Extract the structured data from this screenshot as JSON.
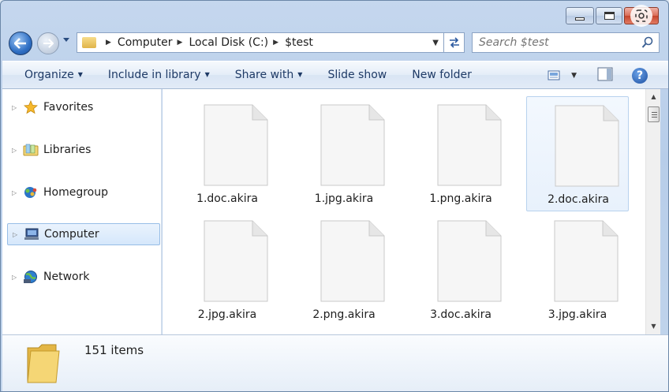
{
  "window": {
    "colors": {
      "accent": "#2f6fc4",
      "close": "#d96c57",
      "selection": "#d5e7fb"
    }
  },
  "address": {
    "crumbs": [
      "Computer",
      "Local Disk (C:)",
      "$test"
    ]
  },
  "search": {
    "placeholder": "Search $test"
  },
  "toolbar": {
    "organize": "Organize",
    "include_in_library": "Include in library",
    "share_with": "Share with",
    "slide_show": "Slide show",
    "new_folder": "New folder"
  },
  "nav": {
    "items": [
      {
        "label": "Favorites",
        "icon": "star-icon"
      },
      {
        "label": "Libraries",
        "icon": "libraries-icon"
      },
      {
        "label": "Homegroup",
        "icon": "homegroup-icon"
      },
      {
        "label": "Computer",
        "icon": "computer-icon",
        "selected": true
      },
      {
        "label": "Network",
        "icon": "network-icon"
      }
    ]
  },
  "files": [
    {
      "name": "1.doc.akira"
    },
    {
      "name": "1.jpg.akira"
    },
    {
      "name": "1.png.akira"
    },
    {
      "name": "2.doc.akira",
      "selected": true
    },
    {
      "name": "2.jpg.akira"
    },
    {
      "name": "2.png.akira"
    },
    {
      "name": "3.doc.akira"
    },
    {
      "name": "3.jpg.akira"
    }
  ],
  "details": {
    "item_count": "151 items"
  }
}
